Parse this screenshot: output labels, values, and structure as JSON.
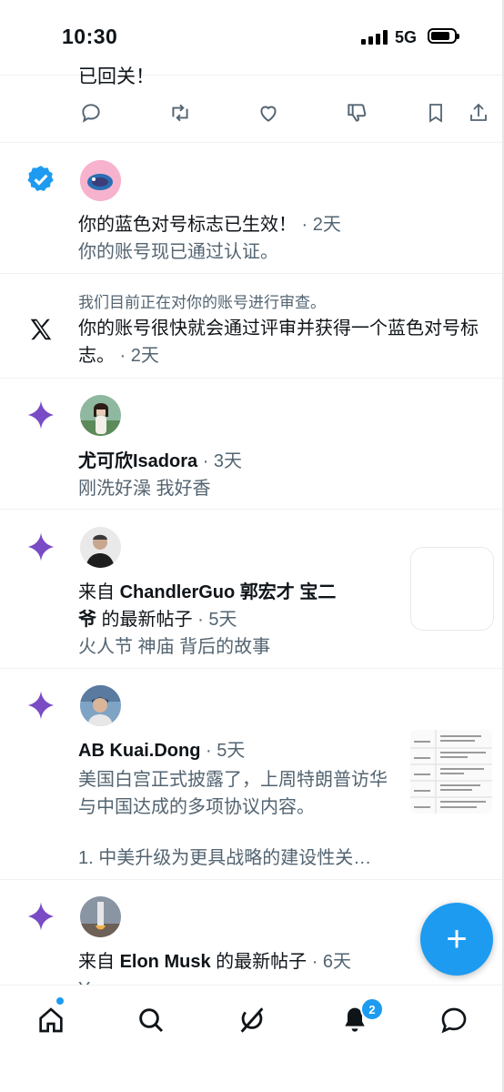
{
  "status_bar": {
    "time": "10:30",
    "network": "5G"
  },
  "partial_tweet": {
    "text": "已回关！"
  },
  "notifications": [
    {
      "type": "verified",
      "title": "你的蓝色对号标志已生效！",
      "time": " · 2天",
      "body": "你的账号现已通过认证。"
    },
    {
      "type": "x",
      "header": "我们目前正在对你的账号进行审查。",
      "text": "你的账号很快就会通过评审并获得一个蓝色对号标志。",
      "time": " · 2天"
    },
    {
      "type": "spark",
      "author": "尤可欣Isadora",
      "time": " · 3天",
      "body": "刚洗好澡 我好香"
    },
    {
      "type": "spark",
      "prefix": "来自 ",
      "author": "ChandlerGuo 郭宏才 宝二爷",
      "suffix": " 的最新帖子",
      "time": " · 5天",
      "body": "火人节 神庙 背后的故事"
    },
    {
      "type": "spark",
      "author": "AB Kuai.Dong",
      "time": " · 5天",
      "body": "美国白宫正式披露了，上周特朗普访华与中国达成的多项协议内容。",
      "body2": "1. 中美升级为更具战略的建设性关…"
    },
    {
      "type": "spark",
      "prefix": "来自 ",
      "author": "Elon Musk",
      "suffix": " 的最新帖子",
      "time": " · 6天",
      "body": "Yes"
    }
  ],
  "fab": {
    "label": "+"
  },
  "nav": {
    "notification_count": "2"
  },
  "colors": {
    "accent": "#1d9bf0",
    "spark": "#794bc4",
    "text": "#0f1419",
    "muted": "#536471"
  }
}
